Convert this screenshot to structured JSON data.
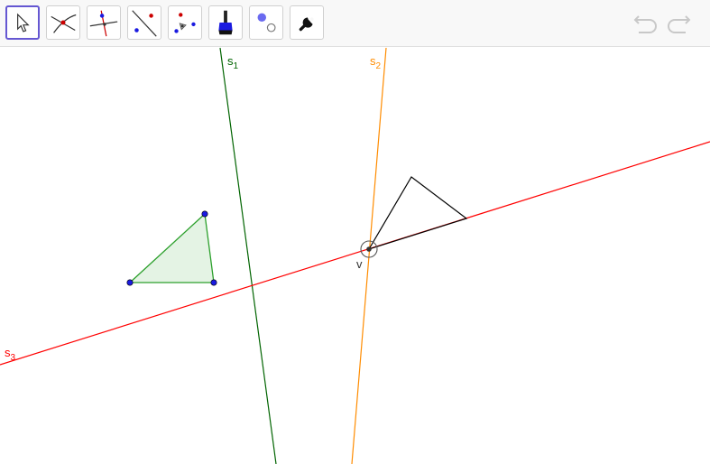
{
  "toolbar": {
    "tools": [
      {
        "name": "move-tool",
        "selected": true
      },
      {
        "name": "intersect-tool"
      },
      {
        "name": "perpendicular-bisector-tool"
      },
      {
        "name": "line-tool"
      },
      {
        "name": "polygon-tool"
      },
      {
        "name": "style-brush-tool"
      },
      {
        "name": "show-hide-object-tool"
      },
      {
        "name": "settings-tool"
      }
    ],
    "undo_icon": "undo-icon",
    "redo_icon": "redo-icon"
  },
  "canvas": {
    "labels": {
      "s1": {
        "base": "s",
        "sub": "1",
        "color": "#006400"
      },
      "s2": {
        "base": "s",
        "sub": "2",
        "color": "#ff8c00"
      },
      "s3": {
        "base": "s",
        "sub": "3",
        "color": "#ff0000"
      },
      "v": {
        "text": "v",
        "color": "#333333"
      }
    },
    "colors": {
      "green_triangle_fill": "#e4f3e4",
      "green_triangle_stroke": "#2ca02c",
      "point": "#1a1ae0"
    }
  }
}
